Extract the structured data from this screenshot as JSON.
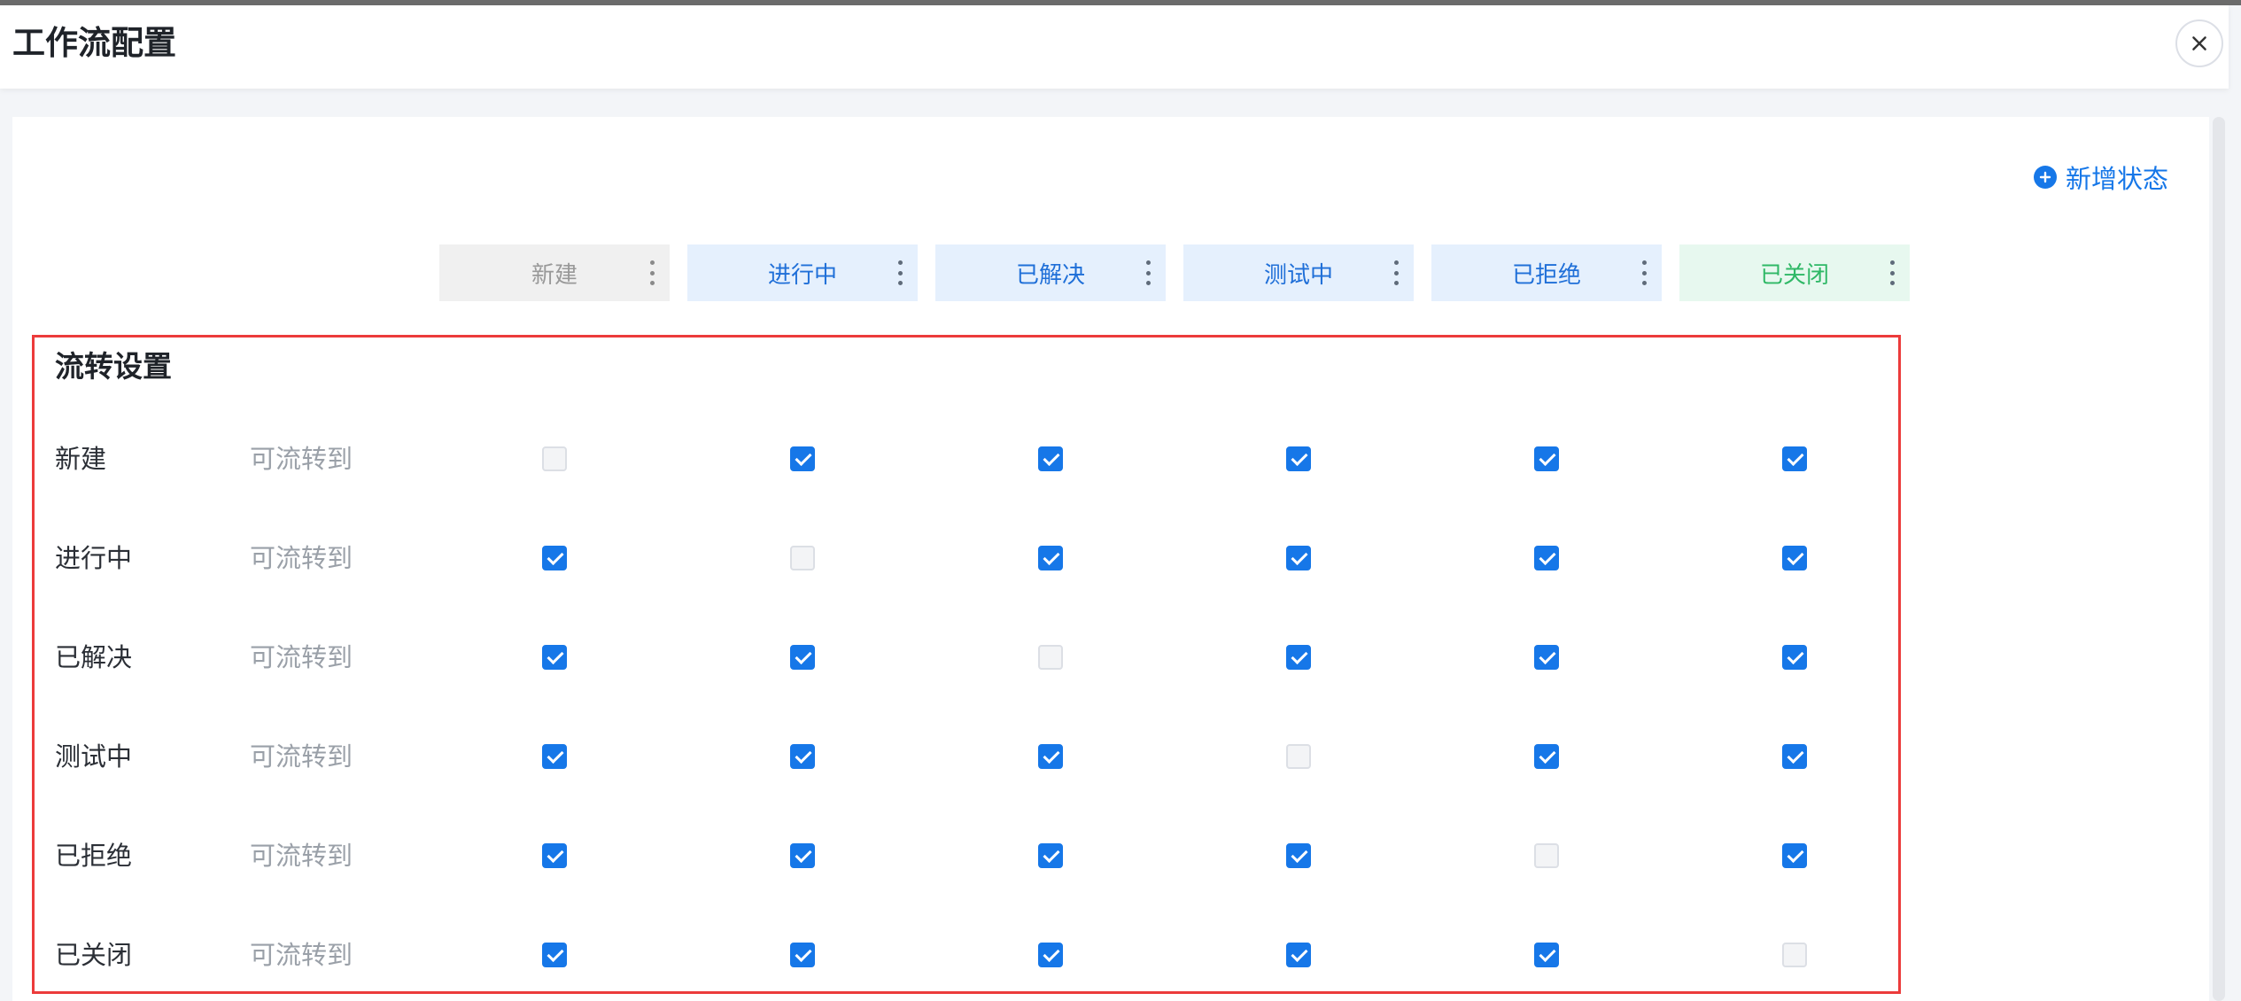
{
  "dialog": {
    "title": "工作流配置"
  },
  "toolbar": {
    "add_status_label": "新增状态"
  },
  "states": [
    {
      "label": "新建",
      "style": "gray"
    },
    {
      "label": "进行中",
      "style": "blue"
    },
    {
      "label": "已解决",
      "style": "blue"
    },
    {
      "label": "测试中",
      "style": "blue"
    },
    {
      "label": "已拒绝",
      "style": "blue"
    },
    {
      "label": "已关闭",
      "style": "green"
    }
  ],
  "flow": {
    "title": "流转设置",
    "rows": [
      {
        "label": "新建",
        "sub": "可流转到",
        "values": [
          null,
          true,
          true,
          true,
          true,
          true
        ]
      },
      {
        "label": "进行中",
        "sub": "可流转到",
        "values": [
          true,
          null,
          true,
          true,
          true,
          true
        ]
      },
      {
        "label": "已解决",
        "sub": "可流转到",
        "values": [
          true,
          true,
          null,
          true,
          true,
          true
        ]
      },
      {
        "label": "测试中",
        "sub": "可流转到",
        "values": [
          true,
          true,
          true,
          null,
          true,
          true
        ]
      },
      {
        "label": "已拒绝",
        "sub": "可流转到",
        "values": [
          true,
          true,
          true,
          true,
          null,
          true
        ]
      },
      {
        "label": "已关闭",
        "sub": "可流转到",
        "values": [
          true,
          true,
          true,
          true,
          true,
          null
        ]
      }
    ]
  },
  "colors": {
    "accent": "#1677e8",
    "highlight_border": "#ec3b3b",
    "blue_header_bg": "#e5f0fd",
    "green_header_bg": "#e7f8ef",
    "gray_header_bg": "#f0f0f0"
  }
}
